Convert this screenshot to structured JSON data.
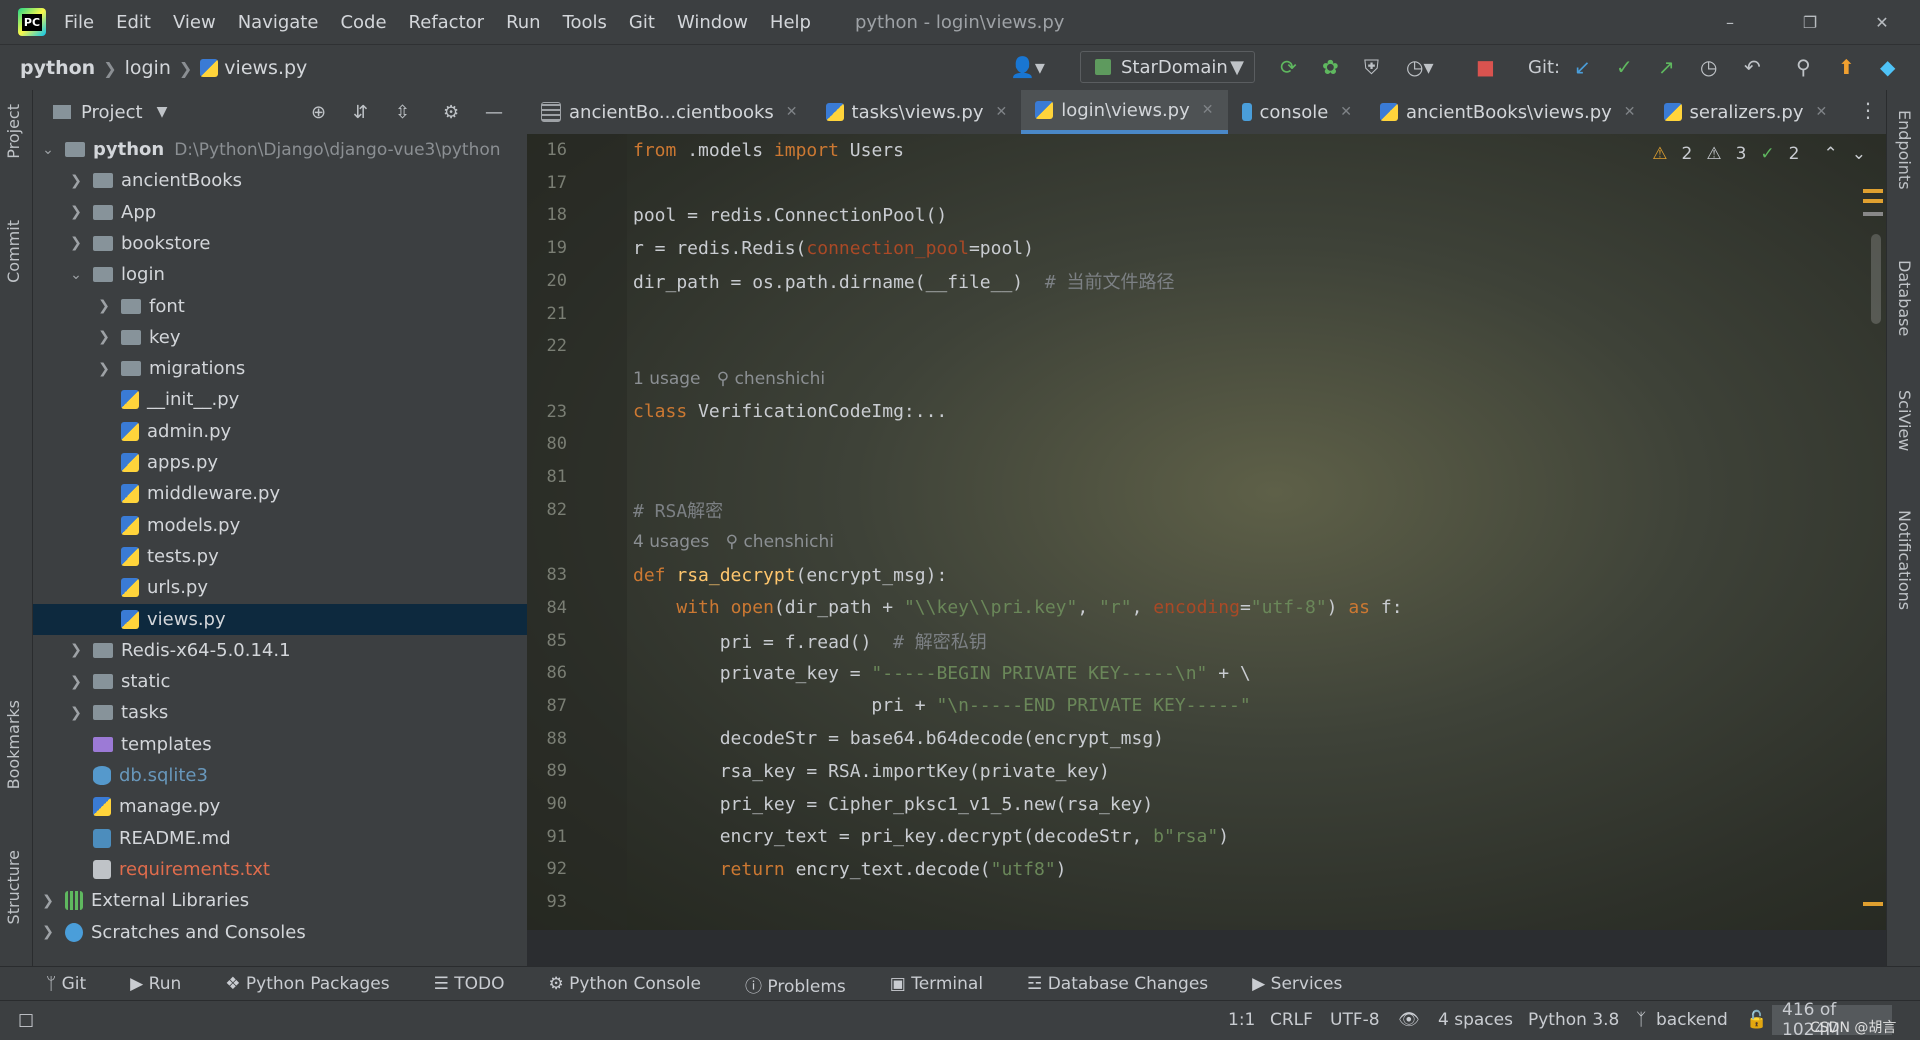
{
  "window": {
    "logo_text": "PC",
    "menu": [
      "File",
      "Edit",
      "View",
      "Navigate",
      "Code",
      "Refactor",
      "Run",
      "Tools",
      "Git",
      "Window",
      "Help"
    ],
    "title": "python - login\\views.py"
  },
  "navbar": {
    "crumbs": [
      "python",
      "login",
      "views.py"
    ],
    "run_config": "StarDomain",
    "git_label": "Git:"
  },
  "left_stripe": [
    "Project",
    "Commit",
    "Bookmarks",
    "Structure"
  ],
  "right_stripe": [
    "Endpoints",
    "Database",
    "SciView",
    "Notifications"
  ],
  "project": {
    "header": "Project",
    "tree": [
      {
        "label": "python",
        "type": "folder",
        "indent": 0,
        "arrow": "v",
        "hint": "D:\\Python\\Django\\django-vue3\\python",
        "bold": true
      },
      {
        "label": "ancientBooks",
        "type": "folder",
        "indent": 1,
        "arrow": ">"
      },
      {
        "label": "App",
        "type": "folder",
        "indent": 1,
        "arrow": ">"
      },
      {
        "label": "bookstore",
        "type": "folder",
        "indent": 1,
        "arrow": ">"
      },
      {
        "label": "login",
        "type": "folder",
        "indent": 1,
        "arrow": "v"
      },
      {
        "label": "font",
        "type": "folder",
        "indent": 2,
        "arrow": ">"
      },
      {
        "label": "key",
        "type": "folder",
        "indent": 2,
        "arrow": ">"
      },
      {
        "label": "migrations",
        "type": "folder",
        "indent": 2,
        "arrow": ">"
      },
      {
        "label": "__init__.py",
        "type": "py",
        "indent": 2,
        "arrow": ""
      },
      {
        "label": "admin.py",
        "type": "py",
        "indent": 2,
        "arrow": ""
      },
      {
        "label": "apps.py",
        "type": "py",
        "indent": 2,
        "arrow": ""
      },
      {
        "label": "middleware.py",
        "type": "py",
        "indent": 2,
        "arrow": ""
      },
      {
        "label": "models.py",
        "type": "py",
        "indent": 2,
        "arrow": ""
      },
      {
        "label": "tests.py",
        "type": "py",
        "indent": 2,
        "arrow": ""
      },
      {
        "label": "urls.py",
        "type": "py",
        "indent": 2,
        "arrow": ""
      },
      {
        "label": "views.py",
        "type": "py",
        "indent": 2,
        "arrow": "",
        "selected": true
      },
      {
        "label": "Redis-x64-5.0.14.1",
        "type": "folder",
        "indent": 1,
        "arrow": ">"
      },
      {
        "label": "static",
        "type": "folder",
        "indent": 1,
        "arrow": ">"
      },
      {
        "label": "tasks",
        "type": "folder",
        "indent": 1,
        "arrow": ">"
      },
      {
        "label": "templates",
        "type": "purple",
        "indent": 1,
        "arrow": ""
      },
      {
        "label": "db.sqlite3",
        "type": "db",
        "indent": 1,
        "arrow": "",
        "color": "#6897bb"
      },
      {
        "label": "manage.py",
        "type": "py",
        "indent": 1,
        "arrow": ""
      },
      {
        "label": "README.md",
        "type": "md",
        "indent": 1,
        "arrow": ""
      },
      {
        "label": "requirements.txt",
        "type": "txt",
        "indent": 1,
        "arrow": "",
        "color": "#e06c4c"
      },
      {
        "label": "External Libraries",
        "type": "lib",
        "indent": 0,
        "arrow": ">"
      },
      {
        "label": "Scratches and Consoles",
        "type": "scratch",
        "indent": 0,
        "arrow": ">"
      }
    ]
  },
  "tabs": [
    {
      "label": "ancientBo...cientbooks",
      "icon": "table",
      "active": false
    },
    {
      "label": "tasks\\views.py",
      "icon": "py",
      "active": false
    },
    {
      "label": "login\\views.py",
      "icon": "py",
      "active": true
    },
    {
      "label": "console",
      "icon": "console",
      "active": false
    },
    {
      "label": "ancientBooks\\views.py",
      "icon": "py",
      "active": false
    },
    {
      "label": "seralizers.py",
      "icon": "py",
      "active": false
    }
  ],
  "inspections": {
    "warn_a": "2",
    "warn_b": "3",
    "ok": "2"
  },
  "editor": {
    "lines": [
      {
        "n": "16",
        "html": "<span class='kw'>from</span> .models <span class='kw'>import</span> Users"
      },
      {
        "n": "17",
        "html": ""
      },
      {
        "n": "18",
        "html": "pool = redis.ConnectionPool()"
      },
      {
        "n": "19",
        "html": "r = redis.Redis(<span class='param'>connection_pool</span>=pool)"
      },
      {
        "n": "20",
        "html": "dir_path = os.path.dirname(__file__)  <span class='cm'># 当前文件路径</span>"
      },
      {
        "n": "21",
        "html": ""
      },
      {
        "n": "22",
        "html": ""
      },
      {
        "n": "",
        "hint": "1 usage   ⚲ chenshichi"
      },
      {
        "n": "23",
        "html": "<span class='kw'>class</span> VerificationCodeImg:..."
      },
      {
        "n": "80",
        "html": ""
      },
      {
        "n": "81",
        "html": ""
      },
      {
        "n": "82",
        "html": "<span class='cm'># RSA解密</span>"
      },
      {
        "n": "",
        "hint": "4 usages   ⚲ chenshichi"
      },
      {
        "n": "83",
        "html": "<span class='kw'>def</span> <span class='fn'>rsa_decrypt</span>(encrypt_msg):"
      },
      {
        "n": "84",
        "html": "    <span class='kw'>with</span> <span class='kw'>open</span>(dir_path + <span class='str'>\"\\\\key\\\\pri.key\"</span>, <span class='str'>\"r\"</span>, <span class='param'>encoding</span>=<span class='str'>\"utf-8\"</span>) <span class='kw'>as</span> f:"
      },
      {
        "n": "85",
        "html": "        pri = f.read()  <span class='cm'># 解密私钥</span>"
      },
      {
        "n": "86",
        "html": "        private_key = <span class='str'>\"-----BEGIN PRIVATE KEY-----\\n\"</span> + \\"
      },
      {
        "n": "87",
        "html": "                      pri + <span class='str'>\"\\n-----END PRIVATE KEY-----\"</span>"
      },
      {
        "n": "88",
        "html": "        decodeStr = base64.b64decode(encrypt_msg)"
      },
      {
        "n": "89",
        "html": "        rsa_key = RSA.importKey(private_key)"
      },
      {
        "n": "90",
        "html": "        pri_key = Cipher_pksc1_v1_5.new(rsa_key)"
      },
      {
        "n": "91",
        "html": "        encry_text = pri_key.decrypt(decodeStr, <span class='str'>b\"rsa\"</span>)"
      },
      {
        "n": "92",
        "html": "        <span class='kw'>return</span> encry_text.decode(<span class='str'>\"utf8\"</span>)"
      },
      {
        "n": "93",
        "html": ""
      }
    ]
  },
  "bottom_tools": [
    "Git",
    "Run",
    "Python Packages",
    "TODO",
    "Python Console",
    "Problems",
    "Terminal",
    "Database Changes",
    "Services"
  ],
  "status": {
    "position": "1:1",
    "line_sep": "CRLF",
    "encoding": "UTF-8",
    "indent": "4 spaces",
    "interpreter": "Python 3.8",
    "branch": "backend",
    "memory": "416 of 1024M",
    "watermark": "CSDN @胡言"
  }
}
